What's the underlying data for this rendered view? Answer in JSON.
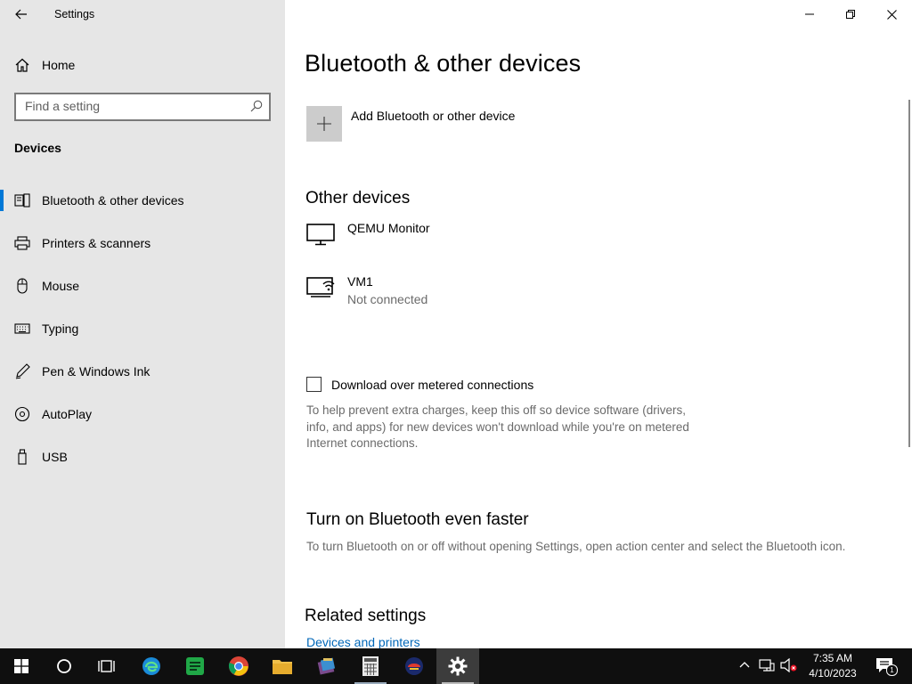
{
  "window": {
    "title": "Settings",
    "controls": {
      "minimize": "minimize-icon",
      "maximize": "restore-icon",
      "close": "close-icon"
    }
  },
  "sidebar": {
    "home_label": "Home",
    "search_placeholder": "Find a setting",
    "section_label": "Devices",
    "items": [
      {
        "label": "Bluetooth & other devices",
        "icon": "bluetooth-devices-icon",
        "selected": true
      },
      {
        "label": "Printers & scanners",
        "icon": "printer-icon",
        "selected": false
      },
      {
        "label": "Mouse",
        "icon": "mouse-icon",
        "selected": false
      },
      {
        "label": "Typing",
        "icon": "keyboard-icon",
        "selected": false
      },
      {
        "label": "Pen & Windows Ink",
        "icon": "pen-icon",
        "selected": false
      },
      {
        "label": "AutoPlay",
        "icon": "autoplay-icon",
        "selected": false
      },
      {
        "label": "USB",
        "icon": "usb-icon",
        "selected": false
      }
    ]
  },
  "main": {
    "title": "Bluetooth & other devices",
    "add_device_label": "Add Bluetooth or other device",
    "other_devices": {
      "heading": "Other devices",
      "devices": [
        {
          "name": "QEMU Monitor",
          "status": "",
          "icon": "monitor-icon"
        },
        {
          "name": "VM1",
          "status": "Not connected",
          "icon": "network-device-icon"
        }
      ]
    },
    "metered": {
      "label": "Download over metered connections",
      "checked": false,
      "help_text": "To help prevent extra charges, keep this off so device software (drivers, info, and apps) for new devices won't download while you're on metered Internet connections."
    },
    "bluetooth_faster": {
      "heading": "Turn on Bluetooth even faster",
      "text": "To turn Bluetooth on or off without opening Settings, open action center and select the Bluetooth icon."
    },
    "related": {
      "heading": "Related settings",
      "link": "Devices and printers"
    }
  },
  "taskbar": {
    "apps": [
      "start-icon",
      "search-circle-icon",
      "task-view-icon",
      "edge-icon",
      "sheets-icon",
      "chrome-icon",
      "file-explorer-icon",
      "winrar-icon",
      "calculator-icon",
      "app-icon",
      "settings-icon"
    ],
    "time": "7:35 AM",
    "date": "4/10/2023",
    "notification_count": "1",
    "colors": {
      "accent": "#0078d7",
      "link": "#0067b8",
      "taskbar": "#0f0f0f",
      "sidebar": "#e6e6e6"
    }
  }
}
